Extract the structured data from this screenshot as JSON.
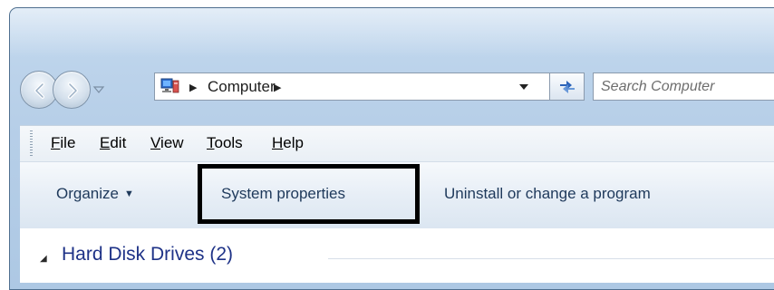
{
  "address_bar": {
    "breadcrumbs": [
      "Computer"
    ],
    "icon": "computer-icon"
  },
  "search": {
    "placeholder": "Search Computer"
  },
  "menu": {
    "items": [
      {
        "accel": "F",
        "rest": "ile"
      },
      {
        "accel": "E",
        "rest": "dit"
      },
      {
        "accel": "V",
        "rest": "iew"
      },
      {
        "accel": "T",
        "rest": "ools"
      },
      {
        "accel": "H",
        "rest": "elp"
      }
    ]
  },
  "command_bar": {
    "organize": "Organize",
    "system_properties": "System properties",
    "uninstall": "Uninstall or change a program"
  },
  "content": {
    "group_title": "Hard Disk Drives (2)"
  },
  "colors": {
    "command_text": "#1e395b",
    "group_title": "#1e3287",
    "highlight_border": "#000000"
  }
}
